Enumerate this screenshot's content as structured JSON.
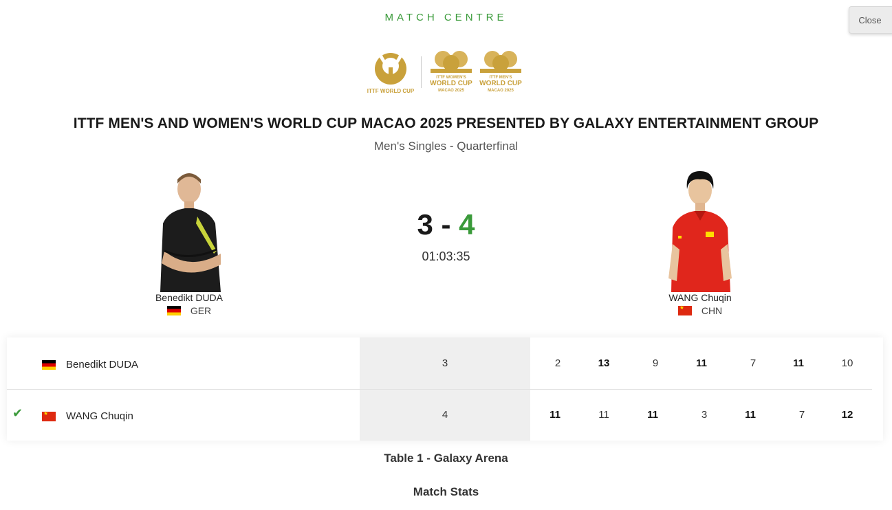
{
  "header": {
    "label": "MATCH CENTRE",
    "close_label": "Close"
  },
  "logos": {
    "main_text": "ITTF WORLD CUP",
    "women": [
      "ITTF WOMEN'S",
      "WORLD CUP",
      "MACAO 2025"
    ],
    "men": [
      "ITTF MEN'S",
      "WORLD CUP",
      "MACAO 2025"
    ],
    "gold": "#c9a13b"
  },
  "event": {
    "title": "ITTF MEN'S AND WOMEN'S WORLD CUP MACAO 2025 PRESENTED BY GALAXY ENTERTAINMENT GROUP",
    "subtitle": "Men's Singles - Quarterfinal"
  },
  "players": {
    "left": {
      "name": "Benedikt DUDA",
      "country": "GER",
      "flag": "germany-flag"
    },
    "right": {
      "name": "WANG Chuqin",
      "country": "CHN",
      "flag": "china-flag"
    }
  },
  "score": {
    "left": "3",
    "separator": "-",
    "right": "4",
    "duration": "01:03:35",
    "winner_color": "#3a9a3a"
  },
  "scoreboard": {
    "rows": [
      {
        "name": "Benedikt DUDA",
        "games": "3",
        "winner": false,
        "sets": [
          "2",
          "13",
          "9",
          "11",
          "7",
          "11",
          "10"
        ]
      },
      {
        "name": "WANG Chuqin",
        "games": "4",
        "winner": true,
        "sets": [
          "11",
          "11",
          "11",
          "3",
          "11",
          "7",
          "12"
        ]
      }
    ]
  },
  "footer": {
    "table": "Table 1 - Galaxy Arena",
    "stats": "Match Stats"
  }
}
